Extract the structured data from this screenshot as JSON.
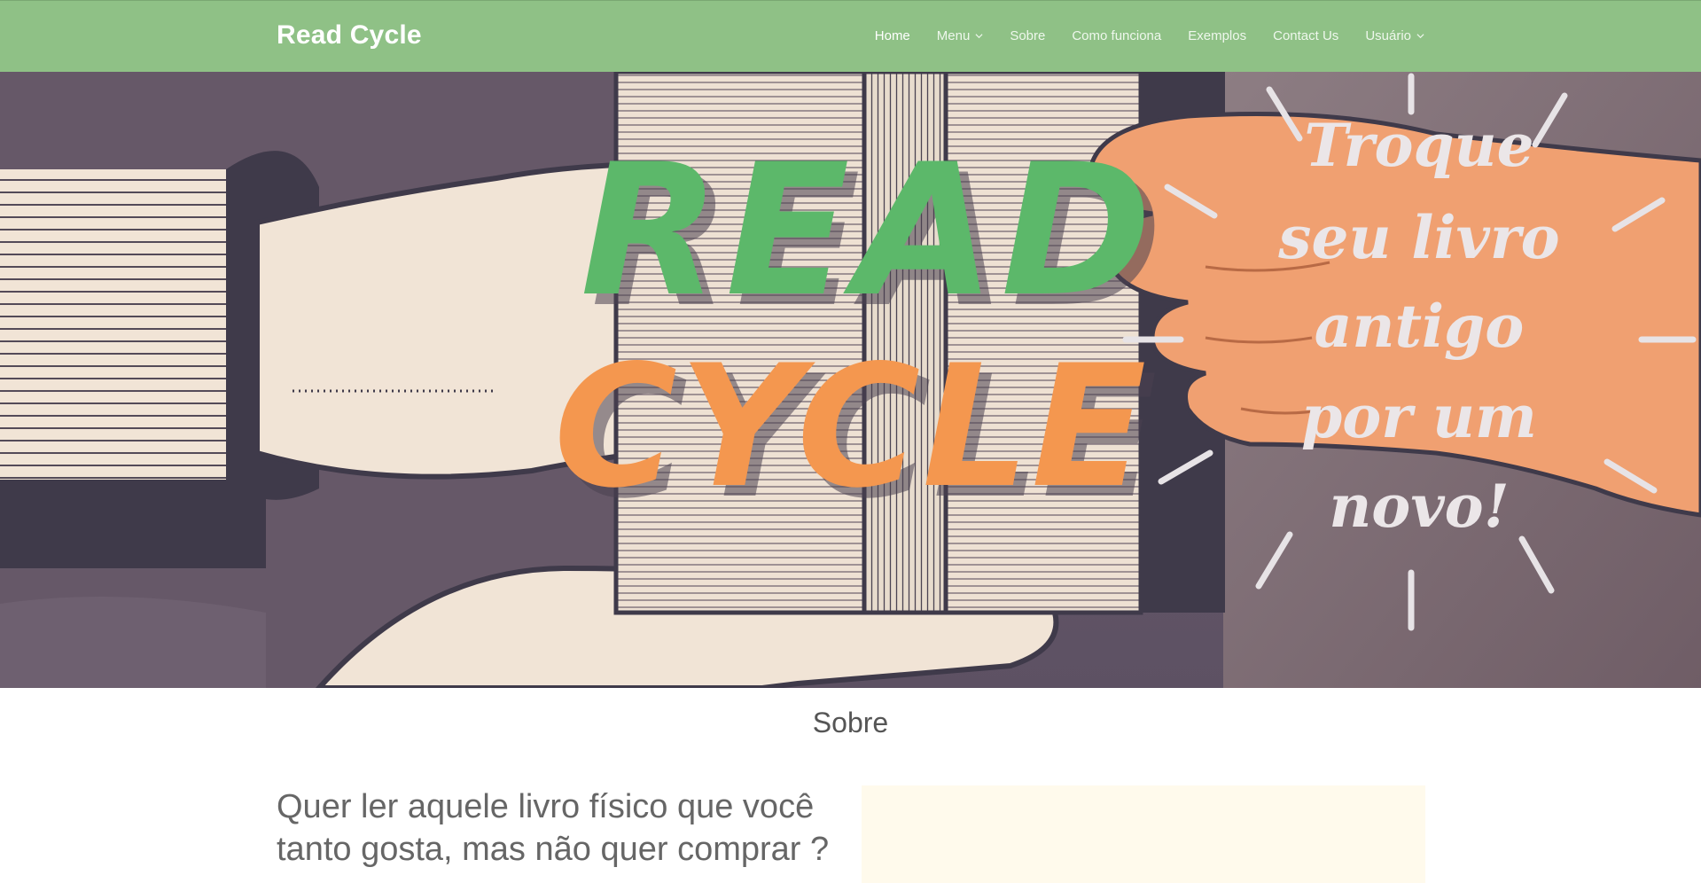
{
  "navbar": {
    "brand": "Read Cycle",
    "items": [
      {
        "label": "Home",
        "active": true,
        "dropdown": false
      },
      {
        "label": "Menu",
        "active": false,
        "dropdown": true
      },
      {
        "label": "Sobre",
        "active": false,
        "dropdown": false
      },
      {
        "label": "Como funciona",
        "active": false,
        "dropdown": false
      },
      {
        "label": "Exemplos",
        "active": false,
        "dropdown": false
      },
      {
        "label": "Contact Us",
        "active": false,
        "dropdown": false
      },
      {
        "label": "Usuário",
        "active": false,
        "dropdown": true
      }
    ]
  },
  "hero": {
    "logo_line1": "READ",
    "logo_line2": "CYCLE",
    "tagline": [
      "Troque",
      "seu livro",
      "antigo",
      "por um",
      "novo!"
    ],
    "colors": {
      "green": "#5cb86a",
      "orange": "#f4974f",
      "purple_bg": "#6b5c6e",
      "dark": "#3f3a4a",
      "cream": "#f1e4d6",
      "skin": "#f0a071"
    }
  },
  "about": {
    "section_title": "Sobre",
    "intro_text": "Quer ler aquele livro físico que você tanto gosta, mas não quer comprar ?"
  },
  "colors": {
    "navbar_bg": "#8fc186",
    "panel_bg": "#fffaec",
    "text_gray": "#666666"
  }
}
